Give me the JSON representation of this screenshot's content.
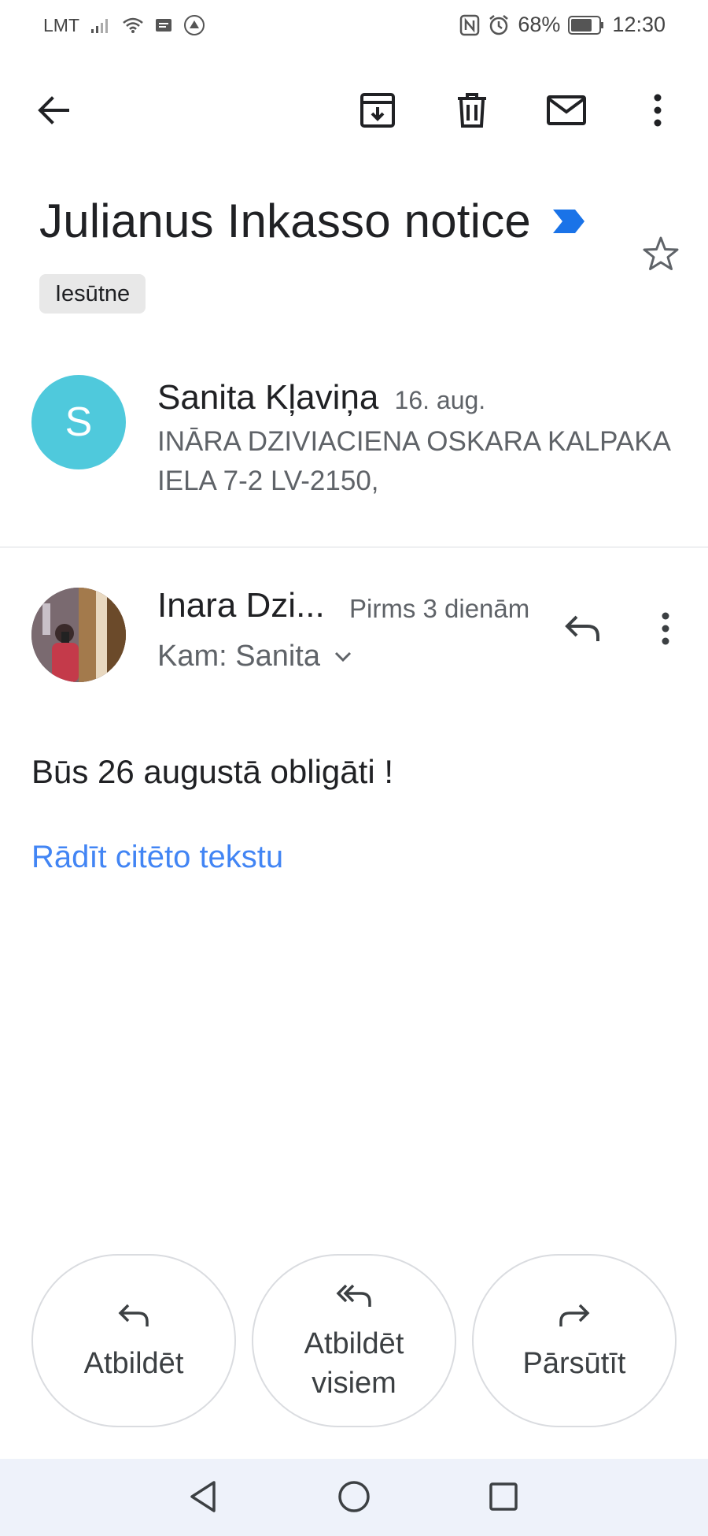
{
  "status_bar": {
    "carrier": "LMT",
    "battery": "68%",
    "time": "12:30",
    "icons": [
      "signal-icon",
      "wifi-icon",
      "message-icon",
      "app-icon",
      "nfc-icon",
      "alarm-icon",
      "battery-icon"
    ]
  },
  "toolbar": {
    "icons": [
      "back-arrow-icon",
      "archive-icon",
      "delete-icon",
      "mark-unread-icon",
      "more-vert-icon"
    ]
  },
  "thread": {
    "subject": "Julianus Inkasso notice",
    "label": "Iesūtne"
  },
  "collapsed_message": {
    "avatar_letter": "S",
    "sender": "Sanita Kļaviņa",
    "date": "16. aug.",
    "snippet": "INĀRA DZIVIACIENA OSKARA KALPAKA IELA 7-2 LV-2150,"
  },
  "expanded_message": {
    "sender": "Inara Dzi...",
    "time": "Pirms 3 dienām",
    "to": "Kam: Sanita",
    "body": "Būs 26 augustā obligāti !",
    "show_quoted": "Rādīt citēto tekstu"
  },
  "actions": {
    "reply": "Atbildēt",
    "reply_all_line1": "Atbildēt",
    "reply_all_line2": "visiem",
    "forward": "Pārsūtīt"
  },
  "colors": {
    "avatar_s": "#4fc9dc",
    "link": "#4285f4",
    "importance": "#1a73e8",
    "navbar": "#eef2fa"
  }
}
